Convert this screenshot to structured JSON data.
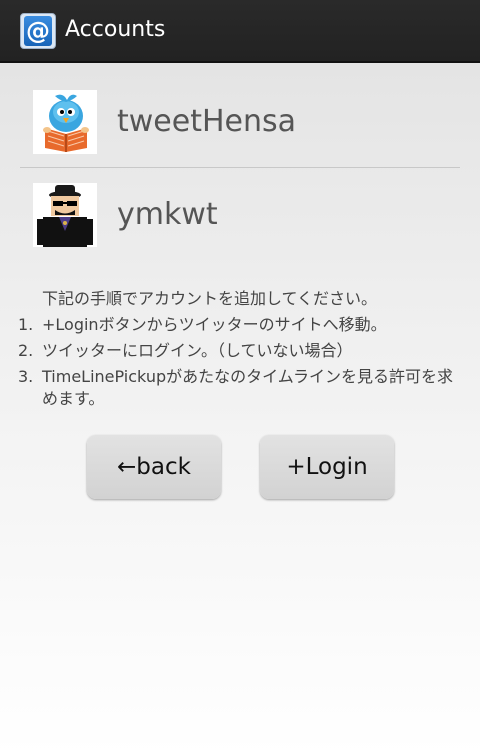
{
  "actionbar": {
    "title": "Accounts",
    "app_icon_glyph": "@"
  },
  "accounts": [
    {
      "name": "tweetHensa",
      "avatar": "bird-reading-book-avatar"
    },
    {
      "name": "ymkwt",
      "avatar": "hat-man-avatar"
    }
  ],
  "instructions": {
    "intro": "下記の手順でアカウントを追加してください。",
    "steps": [
      {
        "num": "1.",
        "text": "+Loginボタンからツイッターのサイトへ移動。"
      },
      {
        "num": "2.",
        "text": "ツイッターにログイン。（していない場合）"
      },
      {
        "num": "3.",
        "text": "TimeLinePickupがあたなのタイムラインを見る許可を求めます。"
      }
    ]
  },
  "buttons": {
    "back": "←back",
    "login": "+Login"
  }
}
